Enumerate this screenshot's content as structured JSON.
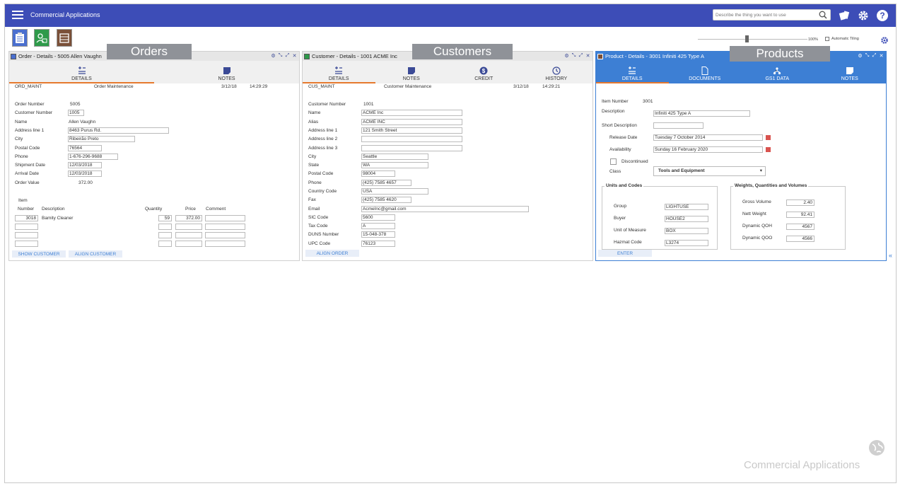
{
  "app": {
    "title": "Commercial Applications",
    "search_placeholder": "Describe the thing you want to use",
    "brand_footer": "Commercial Applications"
  },
  "toolbar": {
    "zoom": "100%",
    "auto_tiling": "Automatic Tiling"
  },
  "overlays": {
    "orders": "Orders",
    "customers": "Customers",
    "products": "Products"
  },
  "orders": {
    "title": "Order - Details - 5005 Allen Vaughn",
    "tabs": [
      "DETAILS",
      "NOTES"
    ],
    "header": {
      "code": "ORD_MAINT",
      "name": "Order Maintenance",
      "date": "3/12/18",
      "time": "14:29:29"
    },
    "fields": {
      "order_number_label": "Order Number",
      "order_number": "5005",
      "customer_number_label": "Customer Number",
      "customer_number": "1005",
      "name_label": "Name",
      "name": "Allen Vaughn",
      "address1_label": "Address line 1",
      "address1": "8463 Purus Rd.",
      "city_label": "City",
      "city": "Ribeirão Preto",
      "postal_label": "Postal Code",
      "postal": "76564",
      "phone_label": "Phone",
      "phone": "1-676-296-9688",
      "ship_label": "Shipment Date",
      "ship": "12/03/2018",
      "arrival_label": "Arrival Date",
      "arrival": "12/03/2018",
      "value_label": "Order Value",
      "value": "372.00"
    },
    "lines": {
      "col_item": "Item",
      "col_number": "Number",
      "col_desc": "Description",
      "col_qty": "Quantity",
      "col_price": "Price",
      "col_comment": "Comment",
      "row1": {
        "number": "3018",
        "desc": "Bamity Cleaner",
        "qty": "59",
        "price": "372.00"
      }
    },
    "buttons": {
      "show_customer": "SHOW CUSTOMER",
      "align_customer": "ALIGN CUSTOMER"
    }
  },
  "customers": {
    "title": "Customer - Details - 1001 ACME Inc",
    "tabs": [
      "DETAILS",
      "NOTES",
      "CREDIT",
      "HISTORY"
    ],
    "header": {
      "code": "CUS_MAINT",
      "name": "Customer Maintenance",
      "date": "3/12/18",
      "time": "14:29:21"
    },
    "fields": {
      "number_label": "Customer Number",
      "number": "1001",
      "name_label": "Name",
      "name": "ACME Inc",
      "alias_label": "Alias",
      "alias": "ACME INC",
      "addr1_label": "Address line 1",
      "addr1": "121 Smith Street",
      "addr2_label": "Address line 2",
      "addr3_label": "Address line 3",
      "city_label": "City",
      "city": "Seattle",
      "state_label": "State",
      "state": "WA",
      "postal_label": "Postal Code",
      "postal": "98004",
      "phone_label": "Phone",
      "phone": "(425) 7585 4657",
      "country_label": "Country Code",
      "country": "USA",
      "fax_label": "Fax",
      "fax": "(425) 7585 4620",
      "email_label": "Email",
      "email": "AcmeInc@gmail.com",
      "sic_label": "SIC Code",
      "sic": "5600",
      "tax_label": "Tax Code",
      "tax": "A",
      "duns_label": "DUNS Number",
      "duns": "15-048-378",
      "upc_label": "UPC Code",
      "upc": "76123"
    },
    "buttons": {
      "align_order": "ALIGN ORDER"
    }
  },
  "products": {
    "title": "Product - Details - 3001 Infiniti 425 Type A",
    "tabs": [
      "DETAILS",
      "DOCUMENTS",
      "GS1 DATA",
      "NOTES"
    ],
    "fields": {
      "item_label": "Item Number",
      "item": "3001",
      "desc_label": "Description",
      "desc": "Infiniti 425 Type A",
      "short_label": "Short Description",
      "release_label": "Release Date",
      "release": "Tuesday 7 October 2014",
      "avail_label": "Availability",
      "avail": "Sunday 16 February 2020",
      "discontinued_label": "Discontinued",
      "class_label": "Class",
      "class": "Tools and Equipment"
    },
    "units": {
      "legend": "Units and Codes",
      "group_label": "Group",
      "group": "LIGHTUSE",
      "buyer_label": "Buyer",
      "buyer": "HOUSE2",
      "uom_label": "Unit of Measure",
      "uom": "BOX",
      "hazmat_label": "Hazmat Code",
      "hazmat": "L3274"
    },
    "weights": {
      "legend": "Weights, Quantities and Volumes",
      "gross_label": "Gross Volume",
      "gross": "2.40",
      "nett_label": "Nett Weight",
      "nett": "92.41",
      "qoh_label": "Dynamic QOH",
      "qoh": "4567",
      "qoo_label": "Dynamic QOO",
      "qoo": "4566"
    },
    "buttons": {
      "enter": "ENTER"
    }
  },
  "colors": {
    "topbar": "#3d4db7",
    "accent": "#e6792e",
    "product_header": "#3d7fd4"
  }
}
